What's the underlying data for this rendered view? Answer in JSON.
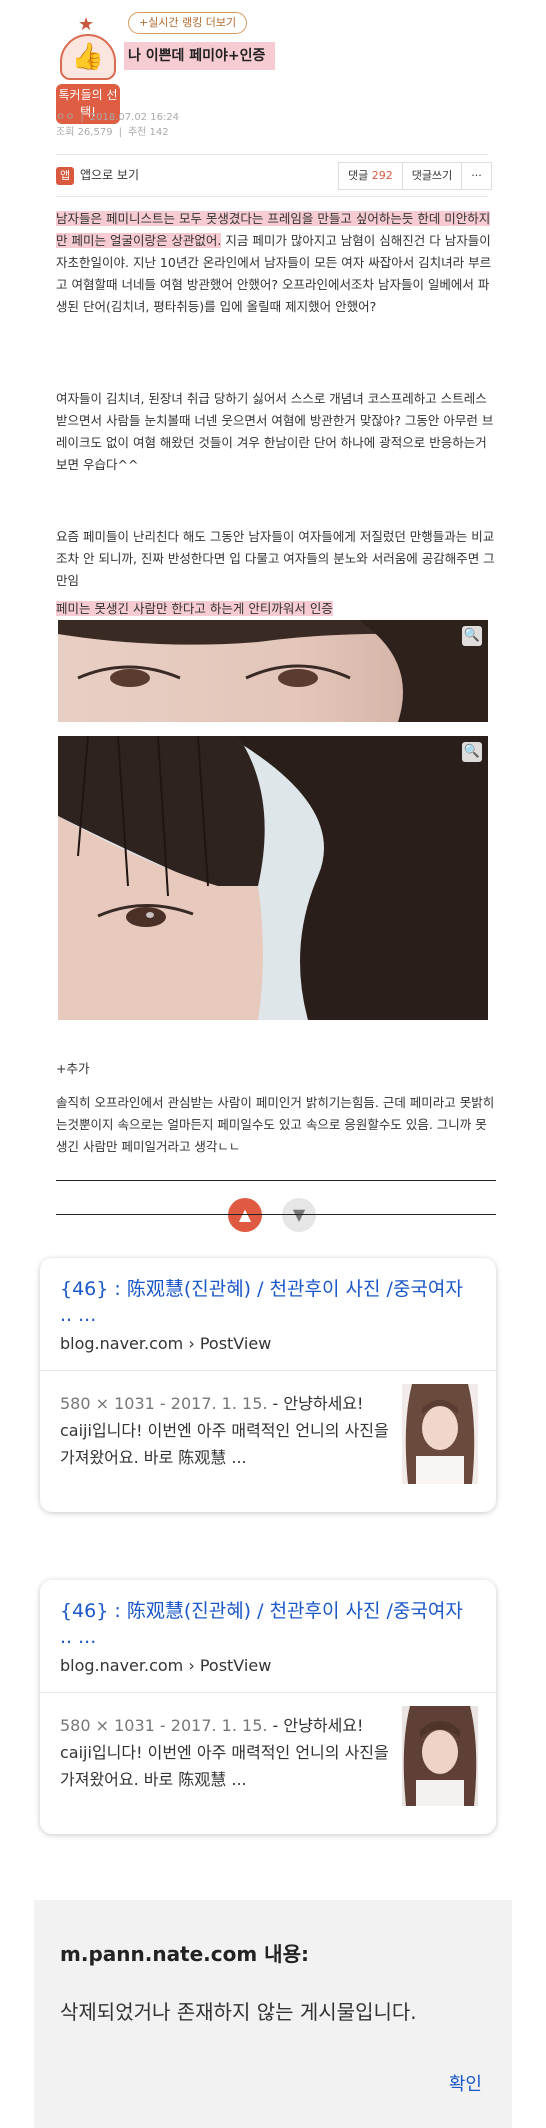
{
  "post": {
    "badge_label": "톡커들의 선택!",
    "ranking_button": "+실시간 랭킹 더보기",
    "title": "나 이쁜데 페미야+인증",
    "author": "ㅇㅇ",
    "date": "2018.07.02 16:24",
    "views": "조회 26,579",
    "recommends": "추천 142",
    "app_view": "앱으로 보기",
    "comments_label": "댓글",
    "comments_count": "292",
    "write_comment": "댓글쓰기",
    "more": "···"
  },
  "body": {
    "para1_hl": "남자들은 페미니스트는 모두 못생겼다는 프레임을 만들고 싶어하는듯 한데 미안하지만 페미는 얼굴이랑은 상관없어.",
    "para1_rest": " 지금 페미가 많아지고 남혐이 심해진건 다 남자들이 자초한일이야. 지난 10년간 온라인에서 남자들이 모든 여자 싸잡아서 김치녀라 부르고 여혐할때 너네들 여혐 방관했어 안했어? 오프라인에서조차 남자들이 일베에서 파생된 단어(김치녀, 평타취등)를 입에 올릴때 제지했어 안했어?",
    "para2": "여자들이 김치녀, 된장녀 취급 당하기 싫어서 스스로 개념녀 코스프레하고 스트레스 받으면서 사람들 눈치볼때 너넨 웃으면서 여혐에 방관한거 맞잖아? 그동안 아무런 브레이크도 없이 여혐 해왔던 것들이 겨우 한남이란 단어 하나에 광적으로 반응하는거보면 우습다^^",
    "para3": "요즘 페미들이 난리친다 해도 그동안 남자들이 여자들에게 저질렀던 만행들과는 비교조차 안 되니까, 진짜 반성한다면 입 다물고 여자들의 분노와 서러움에 공감해주면 그만임",
    "proof_line": "페미는 못생긴 사람만 한다고 하는게 안티까워서 인증",
    "addendum_label": "+추가",
    "addendum": "솔직히 오프라인에서 관심받는 사람이 페미인거 밝히기는힘듬. 근데 페미라고 못밝히는것뿐이지 속으로는 얼마든지 페미일수도 있고 속으로 응원할수도 있음. 그니까 못생긴 사람만 페미일거라고 생각ㄴㄴ"
  },
  "results": [
    {
      "title": "{46} : 陈观慧(진관혜) / 천관후이 사진 /중국여자 .. ...",
      "url": "blog.naver.com › PostView",
      "date": "580 × 1031 - 2017. 1. 15.",
      "snippet": " - 안냥하세요! caiji입니다! 이번엔 아주 매력적인 언니의 사진을 가져왔어요. 바로 陈观慧 ..."
    },
    {
      "title": "{46} : 陈观慧(진관혜) / 천관후이 사진 /중국여자 .. ...",
      "url": "blog.naver.com › PostView",
      "date": "580 × 1031 - 2017. 1. 15.",
      "snippet": " - 안냥하세요! caiji입니다! 이번엔 아주 매력적인 언니의 사진을 가져왔어요. 바로 陈观慧 ..."
    }
  ],
  "dialog": {
    "title": "m.pann.nate.com 내용:",
    "message": "삭제되었거나 존재하지 않는 게시물입니다.",
    "confirm": "확인"
  },
  "colors": {
    "accent": "#d9593f",
    "highlight": "#f6cbd1",
    "link": "#1a57c8"
  },
  "icons": [
    "star-icon",
    "thumbs-up-icon",
    "app-icon",
    "zoom-icon",
    "like-icon",
    "dislike-icon"
  ]
}
